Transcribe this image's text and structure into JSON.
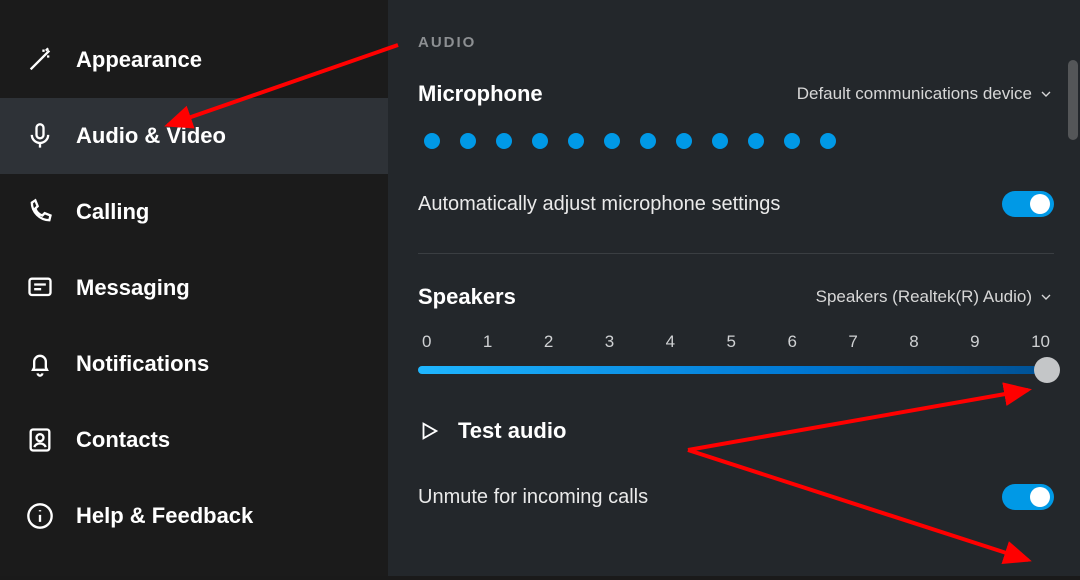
{
  "sidebar": {
    "items": [
      {
        "label": "Appearance"
      },
      {
        "label": "Audio & Video"
      },
      {
        "label": "Calling"
      },
      {
        "label": "Messaging"
      },
      {
        "label": "Notifications"
      },
      {
        "label": "Contacts"
      },
      {
        "label": "Help & Feedback"
      }
    ],
    "selected_index": 1
  },
  "audio": {
    "section_label": "AUDIO",
    "microphone": {
      "heading": "Microphone",
      "device": "Default communications device",
      "level_dots": 12
    },
    "auto_adjust": {
      "label": "Automatically adjust microphone settings",
      "enabled": true
    },
    "speakers": {
      "heading": "Speakers",
      "device": "Speakers (Realtek(R) Audio)",
      "ticks": [
        "0",
        "1",
        "2",
        "3",
        "4",
        "5",
        "6",
        "7",
        "8",
        "9",
        "10"
      ],
      "value": 10
    },
    "test_audio_label": "Test audio",
    "unmute": {
      "label": "Unmute for incoming calls",
      "enabled": true
    }
  },
  "colors": {
    "accent": "#0099e6"
  }
}
